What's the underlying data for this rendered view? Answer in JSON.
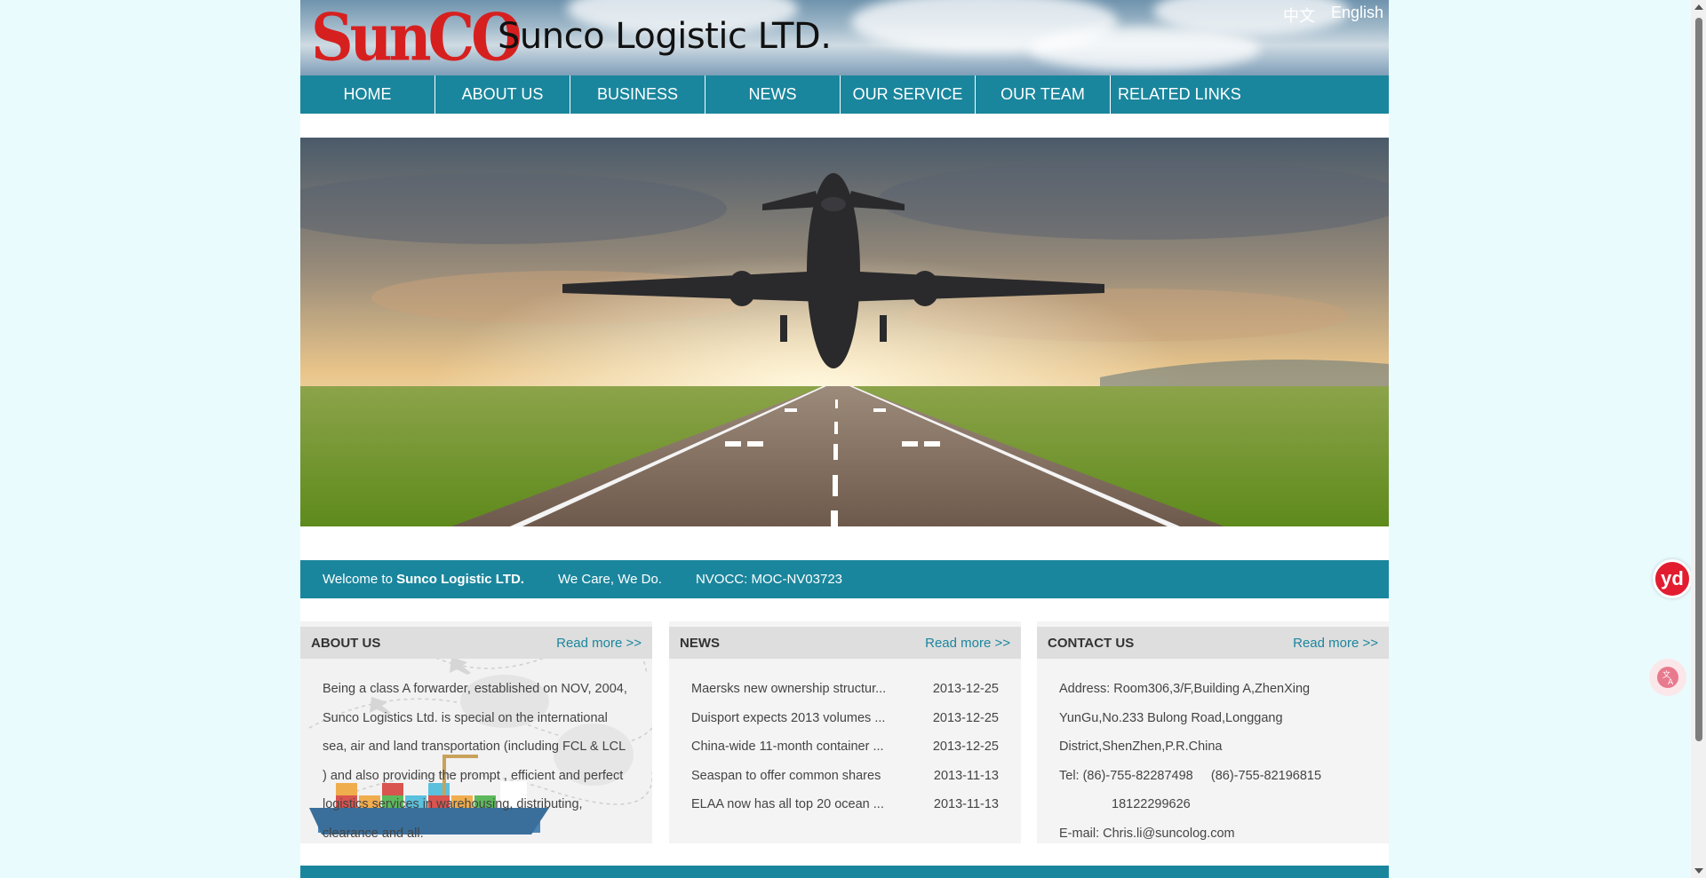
{
  "header": {
    "logo_text": "SunCO",
    "site_title": "Sunco Logistic LTD.",
    "lang_cn": "中文",
    "lang_en": "English"
  },
  "nav": {
    "items": [
      {
        "label": "HOME"
      },
      {
        "label": "ABOUT US"
      },
      {
        "label": "BUSINESS"
      },
      {
        "label": "NEWS"
      },
      {
        "label": "OUR SERVICE"
      },
      {
        "label": "OUR TEAM"
      },
      {
        "label": "RELATED LINKS"
      }
    ]
  },
  "welcome": {
    "prefix": "Welcome to ",
    "company": "Sunco Logistic LTD.",
    "slogan": "We Care, We Do.",
    "nvocc": "NVOCC: MOC-NV03723"
  },
  "about": {
    "title": "ABOUT US",
    "read_more": "Read more >>",
    "text": "Being a class A forwarder, established on NOV, 2004, Sunco Logistics Ltd. is special on the international sea, air and land transportation (including FCL & LCL ) and also providing the prompt , efficient and perfect logistics services in warehousing, distributing, clearance and all."
  },
  "news": {
    "title": "NEWS",
    "read_more": "Read more >>",
    "items": [
      {
        "title": "Maersks new ownership structur...",
        "date": "2013-12-25"
      },
      {
        "title": "Duisport expects 2013 volumes ...",
        "date": "2013-12-25"
      },
      {
        "title": "China-wide 11-month container ...",
        "date": "2013-12-25"
      },
      {
        "title": "Seaspan to offer common shares",
        "date": "2013-11-13"
      },
      {
        "title": "ELAA now has all top 20 ocean ...",
        "date": "2013-11-13"
      }
    ]
  },
  "contact": {
    "title": "CONTACT US",
    "read_more": "Read more >>",
    "address_1": "Address: Room306,3/F,Building A,ZhenXing",
    "address_2": "YunGu,No.233 Bulong Road,Longgang",
    "address_3": "District,ShenZhen,P.R.China",
    "tel_line": "Tel: (86)-755-82287498     (86)-755-82196815",
    "mobile": "18122299626",
    "email": "E-mail: Chris.li@suncolog.com"
  },
  "widgets": {
    "yd_label": "yd",
    "translate_icon": "translate-icon"
  },
  "colors": {
    "accent": "#1a869d",
    "logo_red": "#d6201f",
    "page_bg": "#eafbfd"
  }
}
